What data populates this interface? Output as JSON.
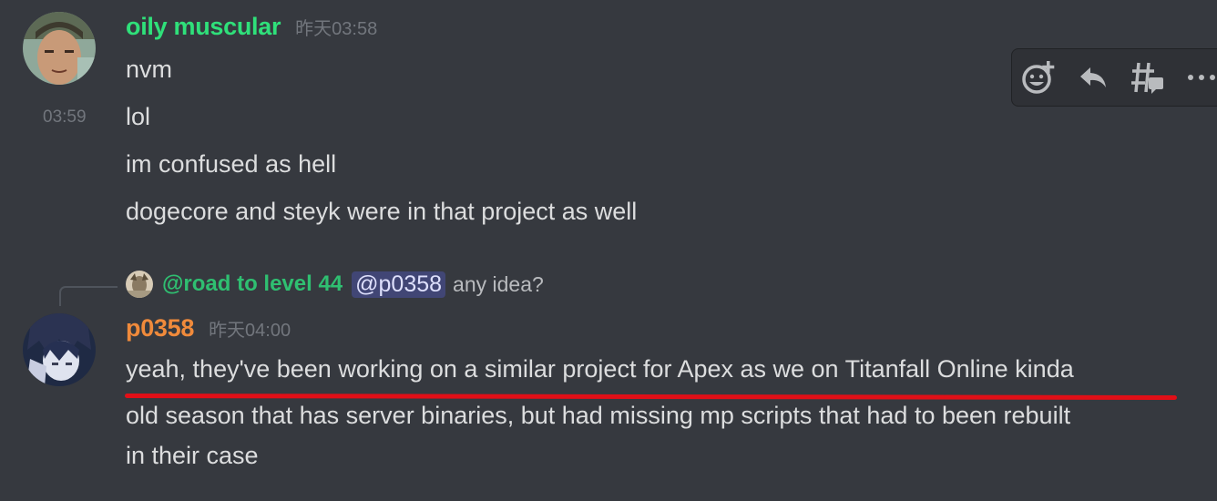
{
  "message_group_1": {
    "username": "oily muscular",
    "username_color": "#2fe07a",
    "timestamp": "昨天03:58",
    "hover_timestamp": "03:59",
    "messages": [
      "nvm",
      "lol",
      "im confused as hell",
      "dogecore and steyk were in that project as well"
    ]
  },
  "toolbar": {
    "buttons": [
      {
        "icon": "add-reaction-icon"
      },
      {
        "icon": "reply-icon"
      },
      {
        "icon": "create-thread-icon"
      },
      {
        "icon": "more-icon"
      }
    ]
  },
  "message_group_2": {
    "reply": {
      "username": "@road to level 44",
      "mention": "@p0358",
      "text": "any idea?"
    },
    "username": "p0358",
    "username_color": "#f08a3b",
    "timestamp": "昨天04:00",
    "messages": [
      "yeah, they've been working on a similar project for Apex as we on Titanfall Online kinda",
      "old season that has server binaries, but had missing mp scripts that had to been rebuilt",
      "in their case"
    ],
    "highlight_color": "#e10f17"
  }
}
